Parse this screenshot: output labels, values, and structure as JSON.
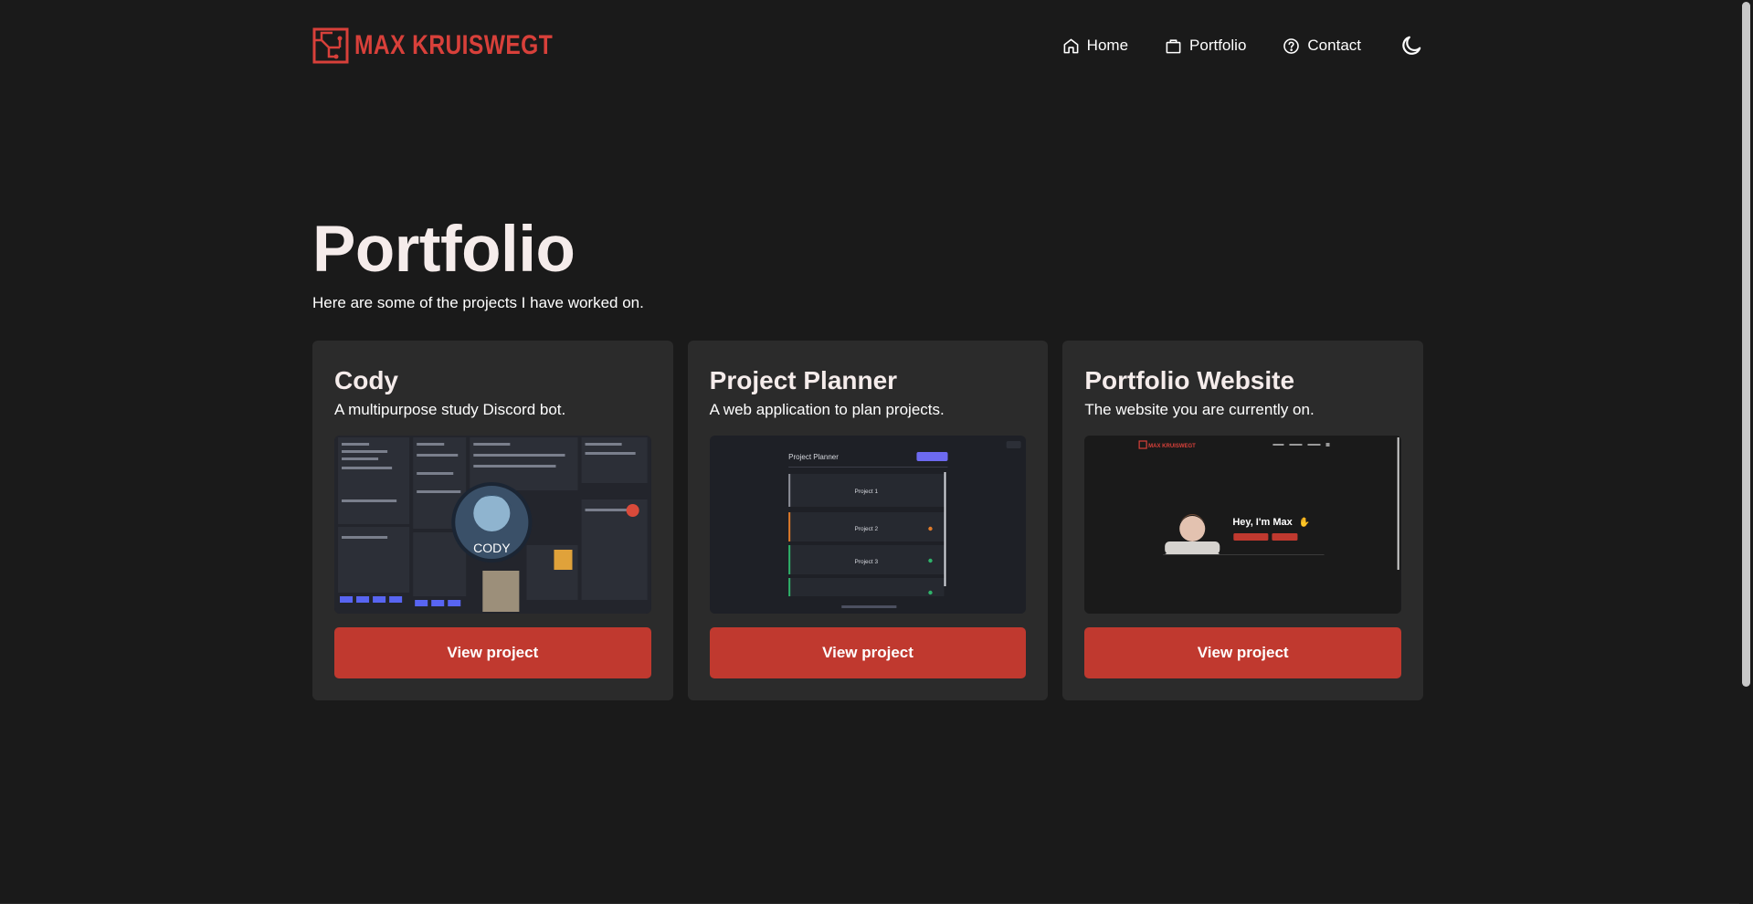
{
  "header": {
    "logo_text": "MAX KRUISWEGT",
    "nav": [
      {
        "label": "Home",
        "icon": "home-icon"
      },
      {
        "label": "Portfolio",
        "icon": "briefcase-icon"
      },
      {
        "label": "Contact",
        "icon": "question-circle-icon"
      }
    ],
    "theme_toggle_icon": "moon-icon"
  },
  "hero": {
    "title": "Portfolio",
    "subtitle": "Here are some of the projects I have worked on."
  },
  "projects": [
    {
      "title": "Cody",
      "description": "A multipurpose study Discord bot.",
      "image_label": "CODY",
      "button_label": "View project"
    },
    {
      "title": "Project Planner",
      "description": "A web application to plan projects.",
      "image_heading": "Project Planner",
      "image_items": [
        "Project 1",
        "Project 2",
        "Project 3"
      ],
      "button_label": "View project"
    },
    {
      "title": "Portfolio Website",
      "description": "The website you are currently on.",
      "image_heading": "Hey, I'm Max",
      "image_logo": "MAX KRUISWEGT",
      "button_label": "View project"
    }
  ],
  "colors": {
    "background": "#1a1a1a",
    "card": "#2b2b2b",
    "accent": "#c0392f",
    "logo": "#d8403a"
  }
}
